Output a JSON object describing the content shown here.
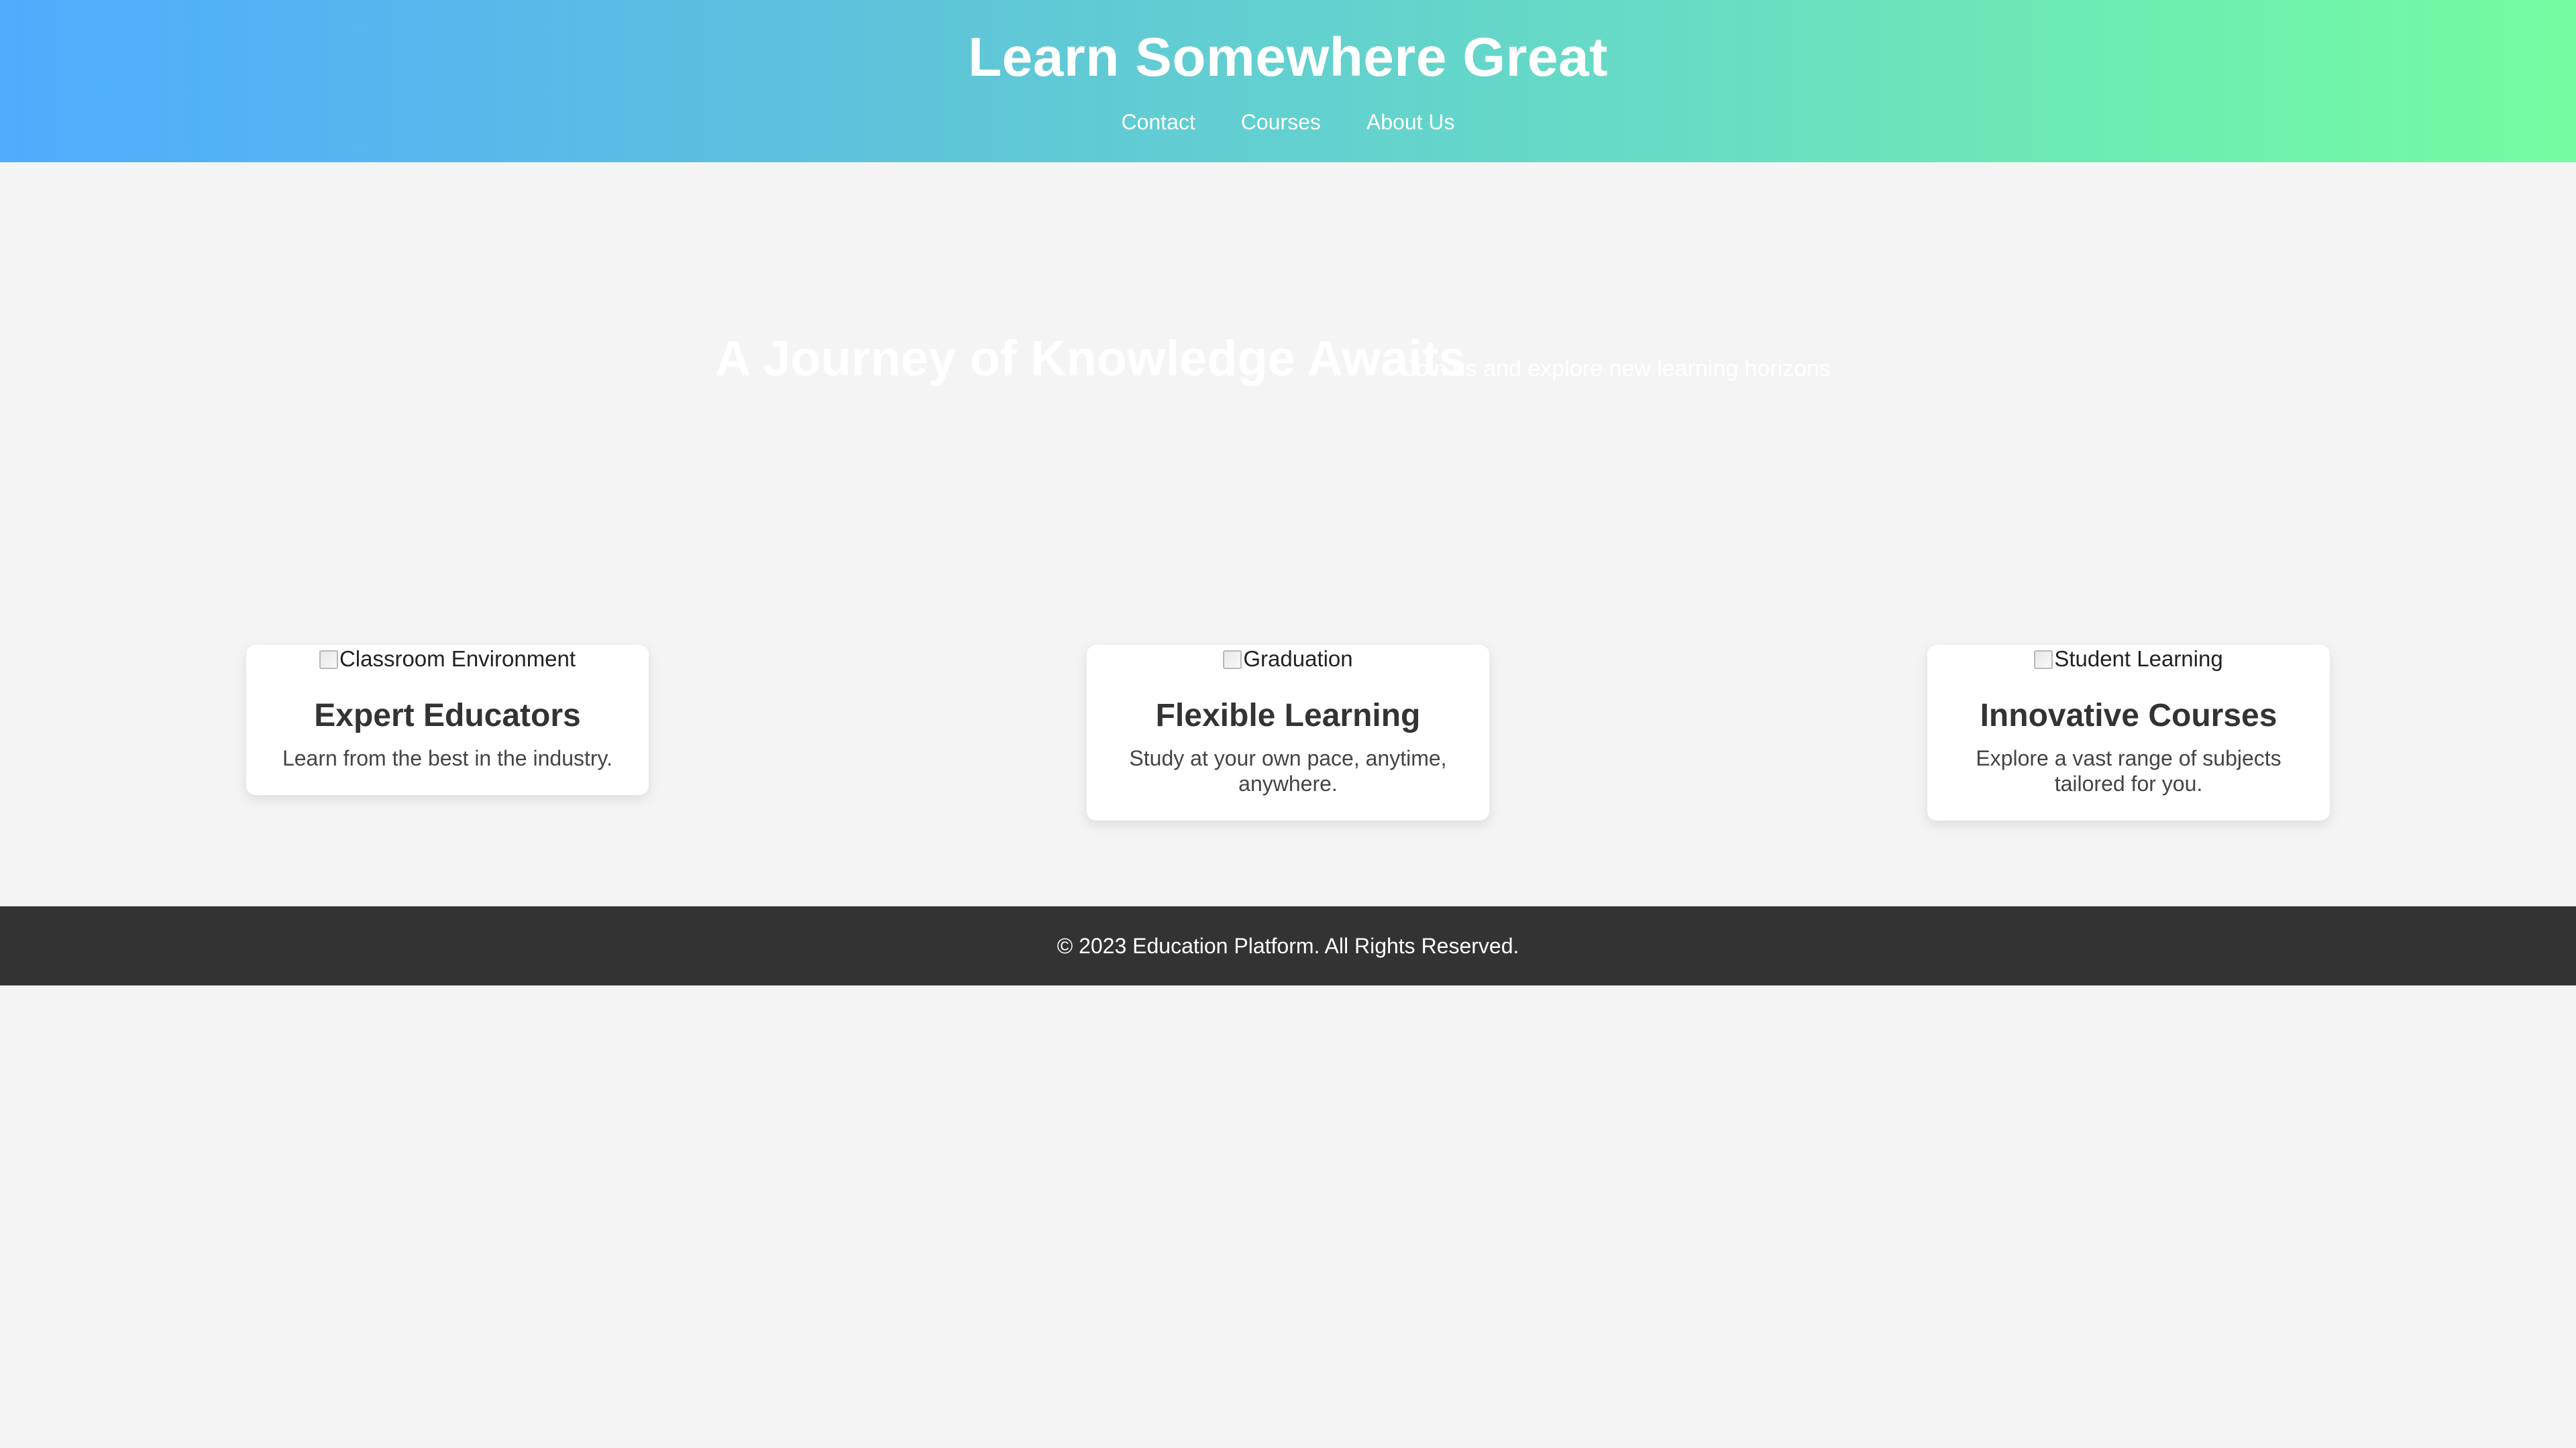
{
  "header": {
    "title": "Learn Somewhere Great",
    "nav": [
      {
        "label": "Contact"
      },
      {
        "label": "Courses"
      },
      {
        "label": "About Us"
      }
    ]
  },
  "hero": {
    "title": "A Journey of Knowledge Awaits",
    "subtitle": "Join us and explore new learning horizons"
  },
  "features": [
    {
      "image_alt": "Classroom Environment",
      "title": "Expert Educators",
      "text": "Learn from the best in the industry."
    },
    {
      "image_alt": "Graduation",
      "title": "Flexible Learning",
      "text": "Study at your own pace, anytime, anywhere."
    },
    {
      "image_alt": "Student Learning",
      "title": "Innovative Courses",
      "text": "Explore a vast range of subjects tailored for you."
    }
  ],
  "footer": {
    "text": "© 2023 Education Platform. All Rights Reserved."
  },
  "colors": {
    "header_gradient_start": "#4facfe",
    "header_gradient_end": "#74fca0",
    "page_background": "#f4f4f4",
    "footer_background": "#333333",
    "heading_text": "#333333",
    "light_text": "#ffffff"
  }
}
